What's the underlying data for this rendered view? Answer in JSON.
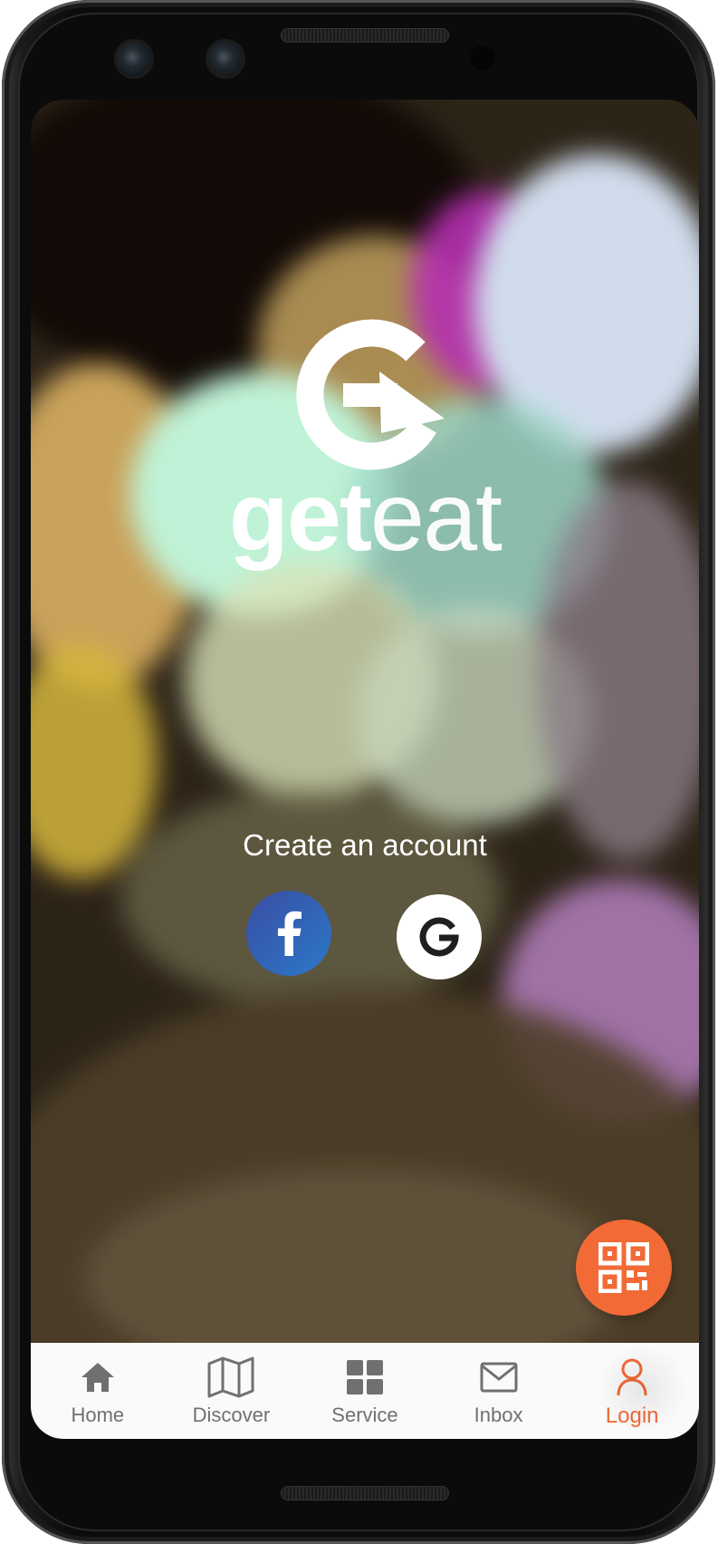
{
  "app": {
    "brand_bold": "get",
    "brand_light": "eat"
  },
  "auth": {
    "cta_label": "Create an account",
    "facebook_glyph": "f",
    "google_glyph": "G"
  },
  "colors": {
    "accent": "#f26a36",
    "facebook": "#3b5998",
    "tab_inactive": "#707070",
    "tabbar_bg": "#fafafa"
  },
  "icons": {
    "logo": "refresh-arrow-logo-icon",
    "qr": "qr-code-icon",
    "home": "home-icon",
    "discover": "map-icon",
    "service": "grid-icon",
    "inbox": "envelope-icon",
    "login": "user-icon"
  },
  "tabs": [
    {
      "label": "Home",
      "active": false
    },
    {
      "label": "Discover",
      "active": false
    },
    {
      "label": "Service",
      "active": false
    },
    {
      "label": "Inbox",
      "active": false
    },
    {
      "label": "Login",
      "active": true
    }
  ]
}
